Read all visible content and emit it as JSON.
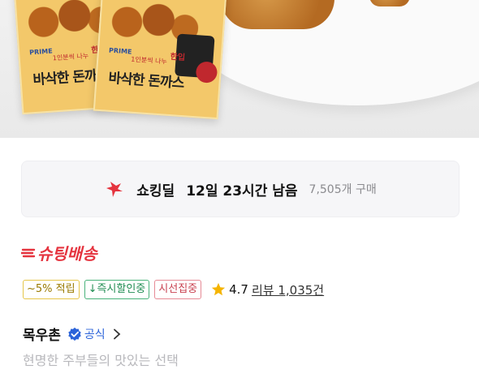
{
  "product_image": {
    "pack_prime": "PRIME",
    "pack_brand": "바삭한 돈까스",
    "pack_tag": "한입",
    "pack_sub": "1인분씩 나누"
  },
  "deal": {
    "icon": "flame-icon",
    "title": "쇼킹딜",
    "timer": "12일 23시간 남음",
    "sold": "7,505개 구매",
    "accent": "#e5343f"
  },
  "delivery": {
    "label": "슈팅배송",
    "color": "#e5343f"
  },
  "badges": {
    "points": "~5% 적립",
    "instant_discount": "↓즉시할인중",
    "attention": "시선집중"
  },
  "rating": {
    "score": "4.7",
    "review": "리뷰 1,035건",
    "score_value": 4.7
  },
  "seller": {
    "name": "목우촌",
    "official": "공식"
  },
  "description": "현명한 주부들의 맛있는 선택"
}
